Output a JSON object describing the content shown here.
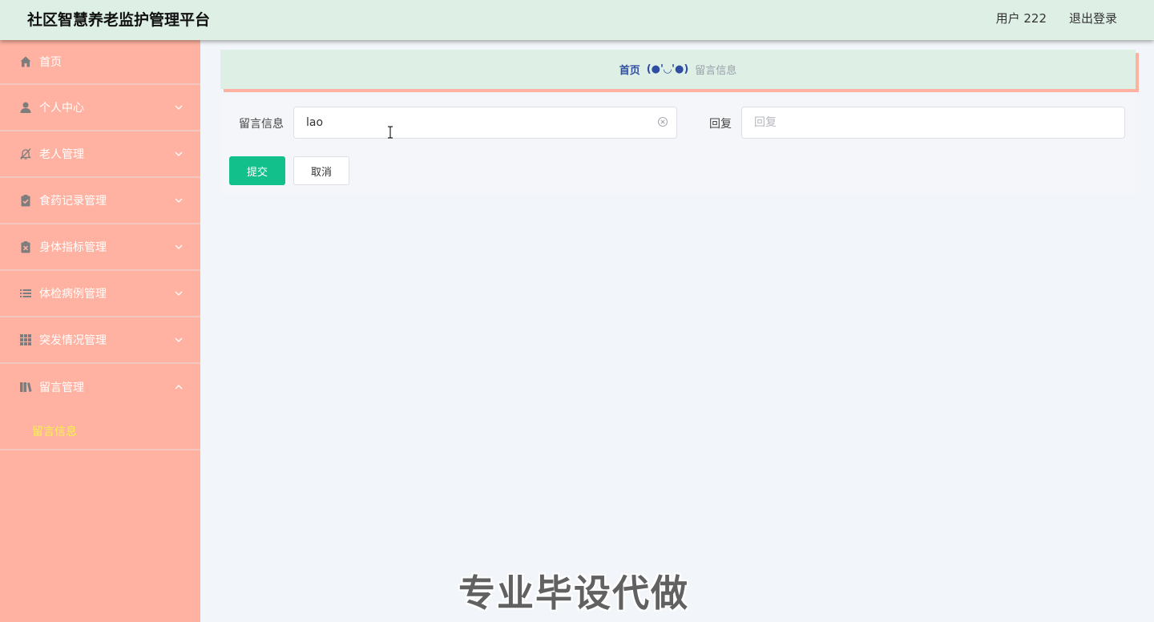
{
  "header": {
    "title": "社区智慧养老监护管理平台",
    "user": "用户 222",
    "logout": "退出登录"
  },
  "sidebar": {
    "items": [
      {
        "label": "首页",
        "icon": "home-icon"
      },
      {
        "label": "个人中心",
        "icon": "person-icon"
      },
      {
        "label": "老人管理",
        "icon": "bell-off-icon"
      },
      {
        "label": "食药记录管理",
        "icon": "clipboard-check-icon"
      },
      {
        "label": "身体指标管理",
        "icon": "clipboard-x-icon"
      },
      {
        "label": "体检病例管理",
        "icon": "list-icon"
      },
      {
        "label": "突发情况管理",
        "icon": "grid-icon"
      },
      {
        "label": "留言管理",
        "icon": "books-icon"
      }
    ],
    "sub_active": "留言信息"
  },
  "breadcrumb": {
    "home": "首页",
    "face": "(●'◡'●)",
    "current": "留言信息"
  },
  "form": {
    "message_label": "留言信息",
    "message_value": "lao",
    "reply_label": "回复",
    "reply_placeholder": "回复",
    "submit": "提交",
    "cancel": "取消"
  },
  "watermark": "专业毕设代做",
  "colors": {
    "header_bg": "#deefe6",
    "sidebar_bg": "#ffb2a1",
    "submenu_active": "#f7f24d",
    "primary": "#11c08a",
    "breadcrumb_link": "#2f4ea1"
  }
}
